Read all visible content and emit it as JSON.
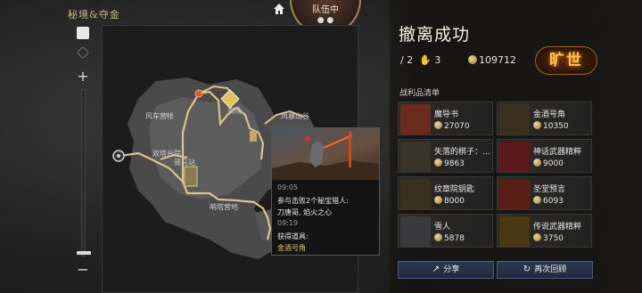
{
  "header": {
    "logo_text": "秘境&夺金",
    "team_label": "队伍中"
  },
  "map": {
    "labels": [
      "风车营帐",
      "农场",
      "风暴山谷",
      "双塔台院",
      "驿马站",
      "哨塔营地"
    ],
    "tooltip": {
      "time1": "09:05",
      "event1_line1": "参与击败2个秘宝猎人:",
      "event1_line2": "刀唐哥, 焰火之心",
      "time2": "09:19",
      "event2_label": "获得道具:",
      "event2_item": "金酒号角"
    }
  },
  "summary": {
    "title": "撤离成功",
    "kills": "2",
    "assists": "3",
    "coins": "109712",
    "rank": "旷世"
  },
  "loot": {
    "title": "战利品清单",
    "items": [
      {
        "name": "魔导书",
        "price": "27070",
        "color": "#6a2a1c",
        "icon": "book-icon"
      },
      {
        "name": "金酒号角",
        "price": "10350",
        "color": "#3a3020",
        "icon": "horn-icon"
      },
      {
        "name": "失落的棋子：...",
        "price": "9863",
        "color": "#3a3428",
        "icon": "chess-piece-icon"
      },
      {
        "name": "神话武器精粹",
        "price": "9000",
        "color": "#5a1818",
        "icon": "red-crystal-icon"
      },
      {
        "name": "纹章院钥匙",
        "price": "8000",
        "color": "#3a3020",
        "icon": "key-icon"
      },
      {
        "name": "圣堂预言",
        "price": "6093",
        "color": "#5a1e14",
        "icon": "scroll-icon"
      },
      {
        "name": "雪人",
        "price": "5878",
        "color": "#3a3a3c",
        "icon": "snowman-icon"
      },
      {
        "name": "传说武器精粹",
        "price": "3750",
        "color": "#4a3814",
        "icon": "gold-crystal-icon"
      }
    ]
  },
  "buttons": {
    "share": "分享",
    "replay": "再次回顾"
  }
}
